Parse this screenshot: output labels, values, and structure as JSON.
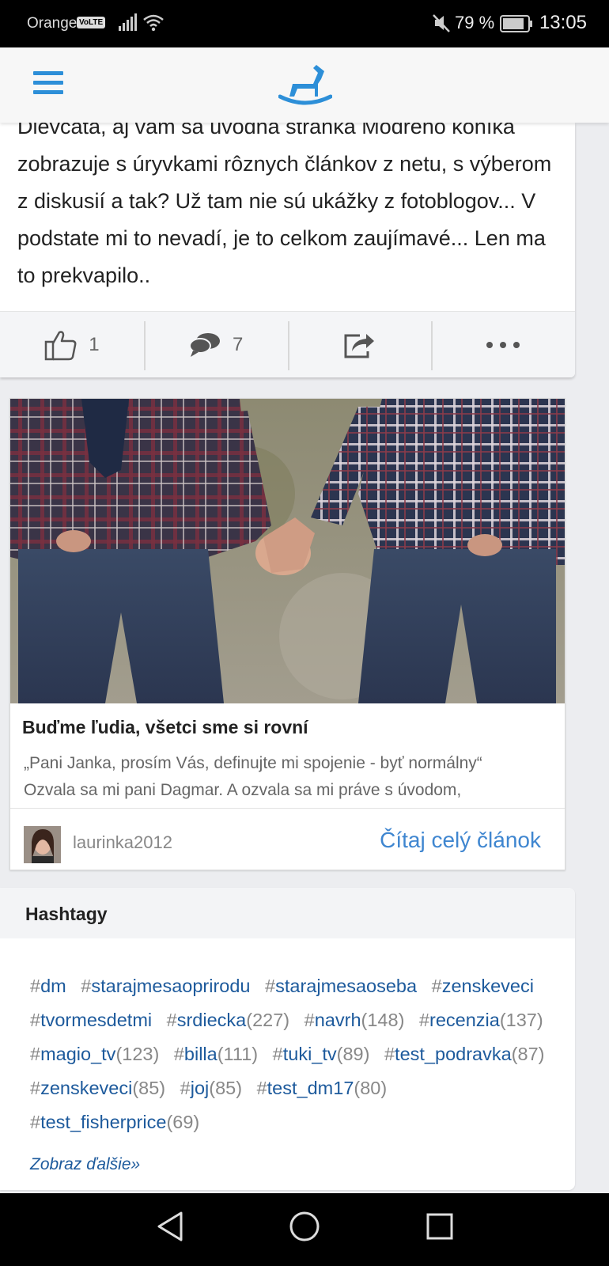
{
  "status_bar": {
    "carrier": "Orange",
    "volte": "VoLTE",
    "battery_percent": "79 %",
    "time": "13:05"
  },
  "header": {
    "menu_icon": "hamburger-icon",
    "logo_icon": "rocking-horse-logo"
  },
  "post": {
    "text": "Dievčatá, aj vám sa úvodná stránka Modrého koníka zobrazuje s úryvkami rôznych článkov z netu, s výberom z diskusií a tak? Už tam nie sú ukážky z fotoblogov... V podstate mi to nevadí, je to celkom zaujímavé... Len ma to prekvapilo..",
    "likes": "1",
    "comments": "7"
  },
  "article": {
    "title": "Buďme ľudia, všetci sme si rovní",
    "excerpt_line1": "„Pani Janka, prosím Vás, definujte mi spojenie - byť normálny“",
    "excerpt_line2": "Ozvala sa mi pani Dagmar. A ozvala sa mi práve s úvodom,",
    "author": "laurinka2012",
    "read_more": "Čítaj celý článok"
  },
  "hashtags": {
    "title": "Hashtagy",
    "tags": [
      {
        "name": "dm",
        "count": ""
      },
      {
        "name": "starajmesaoprirodu",
        "count": ""
      },
      {
        "name": "starajmesaoseba",
        "count": ""
      },
      {
        "name": "zenskeveci",
        "count": ""
      },
      {
        "name": "tvormesdetmi",
        "count": ""
      },
      {
        "name": "srdiecka",
        "count": "(227)"
      },
      {
        "name": "navrh",
        "count": "(148)"
      },
      {
        "name": "recenzia",
        "count": "(137)"
      },
      {
        "name": "magio_tv",
        "count": "(123)"
      },
      {
        "name": "billa",
        "count": "(111)"
      },
      {
        "name": "tuki_tv",
        "count": "(89)"
      },
      {
        "name": "test_podravka",
        "count": "(87)"
      },
      {
        "name": "zenskeveci",
        "count": "(85)"
      },
      {
        "name": "joj",
        "count": "(85)"
      },
      {
        "name": "test_dm17",
        "count": "(80)"
      },
      {
        "name": "test_fisherprice",
        "count": "(69)"
      }
    ],
    "more": "Zobraz ďalšie»"
  },
  "colors": {
    "brand_blue": "#2d8fd8",
    "link_blue": "#3f86d0",
    "tag_blue": "#1d5a9c"
  }
}
